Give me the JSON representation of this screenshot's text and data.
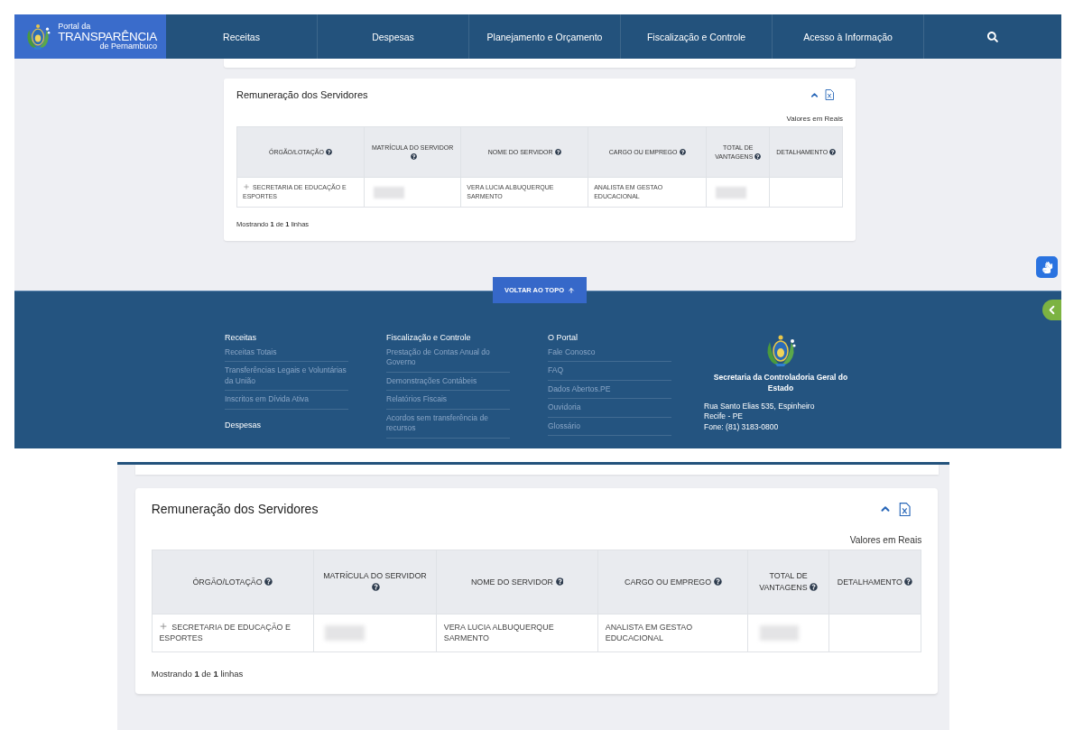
{
  "top": {
    "header": {
      "logo": {
        "line1": "Portal da",
        "line2": "TRANSPARÊNCIA",
        "line3": "de Pernambuco"
      },
      "nav": [
        "Receitas",
        "Despesas",
        "Planejamento e Orçamento",
        "Fiscalização e Controle",
        "Acesso à Informação"
      ]
    },
    "card": {
      "title": "Remuneração dos Servidores",
      "expanded": true,
      "note": "Valores em Reais",
      "columns": [
        {
          "label": "ÓRGÃO/LOTAÇÃO",
          "help": true
        },
        {
          "label": "MATRÍCULA DO SERVIDOR",
          "help": true
        },
        {
          "label": "NOME DO SERVIDOR",
          "help": true
        },
        {
          "label": "CARGO OU EMPREGO",
          "help": true
        },
        {
          "label": "TOTAL DE VANTAGENS",
          "help": true
        },
        {
          "label": "DETALHAMENTO",
          "help": true
        }
      ],
      "rows": [
        {
          "expandable": true,
          "cells": [
            {
              "kind": "text",
              "text": "SECRETARIA DE EDUCAÇÃO E ESPORTES"
            },
            {
              "kind": "redacted"
            },
            {
              "kind": "text",
              "text": "VERA LUCIA ALBUQUERQUE SARMENTO"
            },
            {
              "kind": "text",
              "text": "ANALISTA EM GESTAO EDUCACIONAL"
            },
            {
              "kind": "redacted"
            },
            {
              "kind": "empty"
            }
          ]
        }
      ],
      "summary": "Mostrando **1** de **1** linhas"
    },
    "back_to_top": "VOLTAR AO TOPO",
    "footer": {
      "columns": [
        {
          "groups": [
            {
              "heading": "Receitas",
              "links": [
                "Receitas Totais",
                "Transferências Legais e Voluntárias da União",
                "Inscritos em Dívida Ativa"
              ]
            },
            {
              "heading": "Despesas"
            }
          ]
        },
        {
          "groups": [
            {
              "heading": "Fiscalização e Controle",
              "links": [
                "Prestação de Contas Anual do Governo",
                "Demonstrações Contábeis",
                "Relatórios Fiscais",
                "Acordos sem transferência de recursos"
              ]
            }
          ]
        },
        {
          "groups": [
            {
              "heading": "O Portal",
              "links": [
                "Fale Conosco",
                "FAQ",
                "Dados Abertos.PE",
                "Ouvidoria",
                "Glossário"
              ]
            }
          ]
        }
      ],
      "agency": {
        "name": "Secretaria da Controladoria Geral do Estado",
        "address": [
          "Rua Santo Elias 535, Espinheiro",
          "Recife - PE",
          "Fone: (81) 3183-0800"
        ]
      }
    }
  },
  "bottom": {
    "card": {
      "title": "Remuneração dos Servidores",
      "expanded": true,
      "note": "Valores em Reais",
      "columns": [
        {
          "label": "ÓRGÃO/LOTAÇÃO",
          "help": true
        },
        {
          "label": "MATRÍCULA DO SERVIDOR",
          "help": true
        },
        {
          "label": "NOME DO SERVIDOR",
          "help": true
        },
        {
          "label": "CARGO OU EMPREGO",
          "help": true
        },
        {
          "label": "TOTAL DE VANTAGENS",
          "help": true
        },
        {
          "label": "DETALHAMENTO",
          "help": true
        }
      ],
      "rows": [
        {
          "expandable": true,
          "cells": [
            {
              "kind": "text",
              "text": "SECRETARIA DE EDUCAÇÃO E ESPORTES"
            },
            {
              "kind": "redacted"
            },
            {
              "kind": "text",
              "text": "VERA LUCIA ALBUQUERQUE SARMENTO"
            },
            {
              "kind": "text",
              "text": "ANALISTA EM GESTAO EDUCACIONAL"
            },
            {
              "kind": "redacted"
            },
            {
              "kind": "empty"
            }
          ]
        }
      ],
      "summary": "Mostrando **1** de **1** linhas"
    }
  }
}
